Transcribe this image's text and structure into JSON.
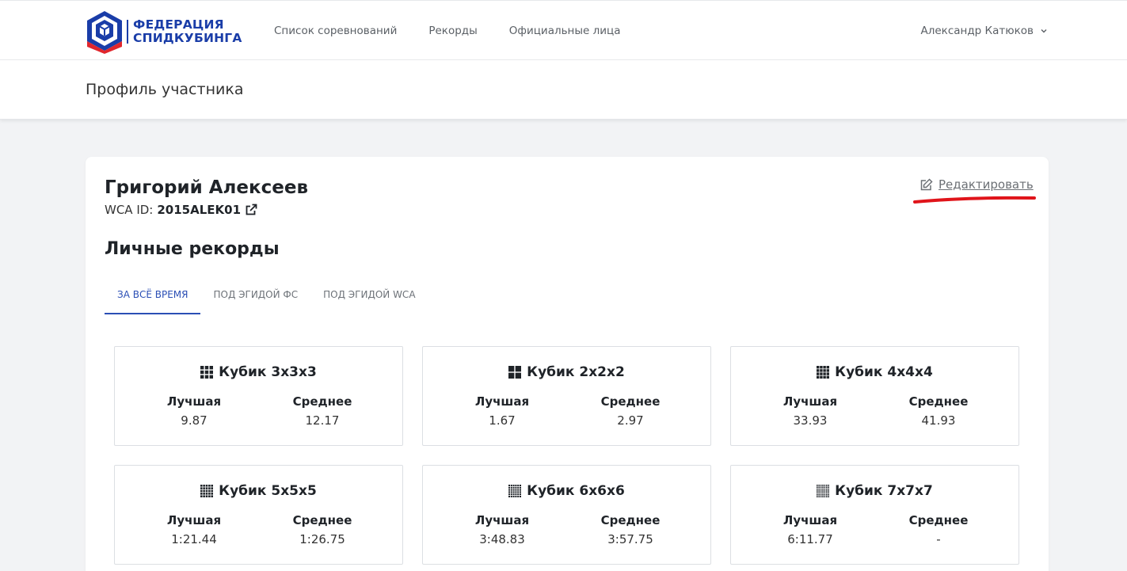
{
  "brand": {
    "line1": "ФЕДЕРАЦИЯ",
    "line2": "СПИДКУБИНГА",
    "colors": {
      "blue": "#1a3da8",
      "red": "#e1262c"
    }
  },
  "nav": {
    "links": [
      "Список соревнований",
      "Рекорды",
      "Официальные лица"
    ],
    "user": "Александр Катюков"
  },
  "page": {
    "title": "Профиль участника"
  },
  "profile": {
    "name": "Григорий Алексеев",
    "wca_label": "WCA ID:",
    "wca_id": "2015ALEK01",
    "edit_label": "Редактировать"
  },
  "records": {
    "title": "Личные рекорды",
    "tabs": [
      "За всё время",
      "Под эгидой ФС",
      "Под эгидой WCA"
    ],
    "best_label": "Лучшая",
    "avg_label": "Среднее",
    "items": [
      {
        "name": "Кубик 3x3x3",
        "icon": "cube-3x3-icon",
        "best": "9.87",
        "avg": "12.17"
      },
      {
        "name": "Кубик 2x2x2",
        "icon": "cube-2x2-icon",
        "best": "1.67",
        "avg": "2.97"
      },
      {
        "name": "Кубик 4x4x4",
        "icon": "cube-4x4-icon",
        "best": "33.93",
        "avg": "41.93"
      },
      {
        "name": "Кубик 5x5x5",
        "icon": "cube-5x5-icon",
        "best": "1:21.44",
        "avg": "1:26.75"
      },
      {
        "name": "Кубик 6x6x6",
        "icon": "cube-6x6-icon",
        "best": "3:48.83",
        "avg": "3:57.75"
      },
      {
        "name": "Кубик 7x7x7",
        "icon": "cube-7x7-icon",
        "best": "6:11.77",
        "avg": "-"
      }
    ]
  }
}
